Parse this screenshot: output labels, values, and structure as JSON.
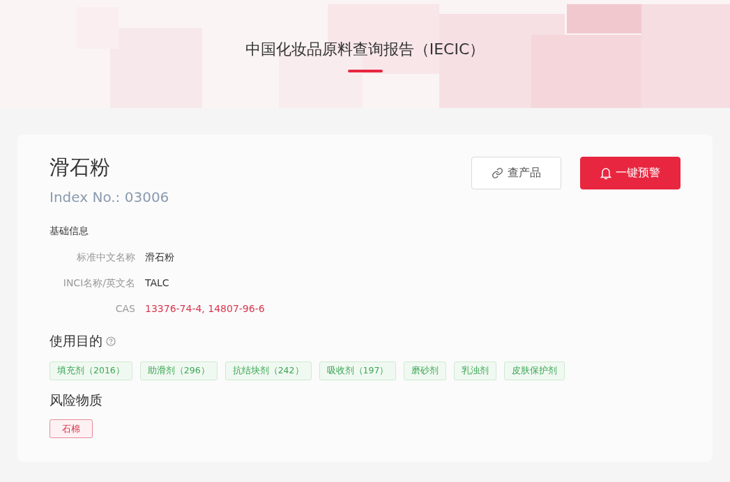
{
  "header": {
    "title": "中国化妆品原料查询报告（IECIC）"
  },
  "ingredient": {
    "name": "滑石粉",
    "index": "Index No.: 03006"
  },
  "buttons": [
    {
      "kind": "outline",
      "label": "查产品"
    },
    {
      "kind": "primary",
      "label": "一键预警"
    }
  ],
  "basic_info": {
    "heading": "基础信息",
    "fields": [
      {
        "label": "标准中文名称",
        "value": "滑石粉",
        "kind": "plain"
      },
      {
        "label": "INCI名称/英文名",
        "value": "TALC",
        "kind": "plain"
      },
      {
        "label": "CAS",
        "value": "13376-74-4, 14807-96-6",
        "kind": "link"
      }
    ]
  },
  "purposes": {
    "heading": "使用目的",
    "tags": [
      "填充剂（2016）",
      "助滑剂（296）",
      "抗结块剂（242）",
      "吸收剂（197）",
      "磨砂剂",
      "乳浊剂",
      "皮肤保护剂"
    ]
  },
  "risks": {
    "heading": "风险物质",
    "tags": [
      "石棉"
    ]
  }
}
